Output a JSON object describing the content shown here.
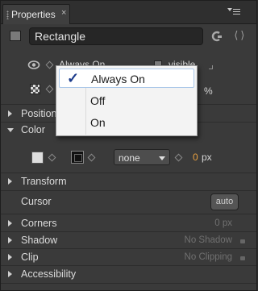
{
  "tab": {
    "title": "Properties",
    "close": "×"
  },
  "header": {
    "element_name": "Rectangle",
    "code_glyph": "⟨⟩"
  },
  "visibility": {
    "value_behind_menu": "Always On",
    "visible_label": "visible",
    "opacity_unit": "%"
  },
  "dropdown": {
    "options": [
      "Always On",
      "Off",
      "On"
    ],
    "selected": "Always On",
    "check": "✓"
  },
  "sections": {
    "position": "Position",
    "color": "Color",
    "transform": "Transform",
    "cursor": "Cursor",
    "corners": "Corners",
    "shadow": "Shadow",
    "clip": "Clip",
    "accessibility": "Accessibility"
  },
  "color": {
    "stroke_style": "none",
    "stroke_width": "0",
    "stroke_unit": "px"
  },
  "cursor": {
    "button_label": "auto"
  },
  "values": {
    "corners": "0 px",
    "shadow": "No Shadow",
    "clip": "No Clipping"
  },
  "colors": {
    "panel_bg": "#3a3a3a",
    "accent_number": "#e8a040",
    "menu_check": "#1b3b8b",
    "menu_selection_border": "#a9c7e8"
  }
}
